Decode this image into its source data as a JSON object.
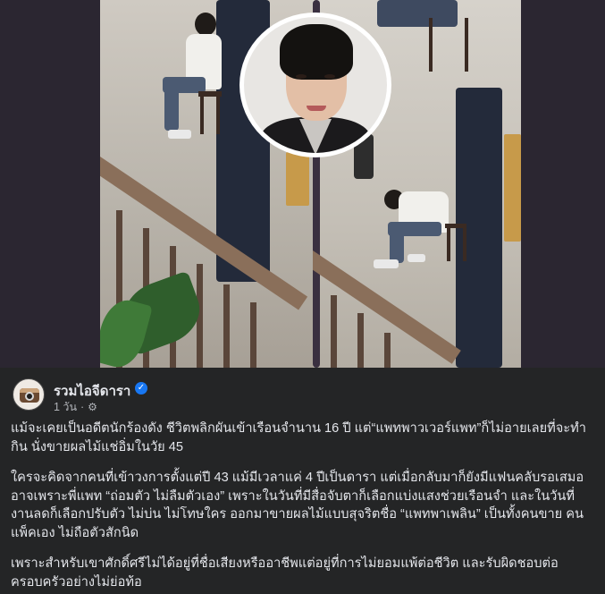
{
  "post": {
    "page_name": "รวมไอจีดารา",
    "time": "1 วัน",
    "separator": "·",
    "verified_icon": "verified-badge-icon",
    "privacy_icon": "gear-icon",
    "paragraphs": [
      "แม้จะเคยเป็นอดีตนักร้องดัง ชีวิตพลิกผันเข้าเรือนจำนาน 16 ปี แต่“แพทพาวเวอร์แพท”ก็ไม่อายเลยที่จะทำกิน นั่งขายผลไม้แช่อิ่มในวัย 45",
      "ใครจะคิดจากคนที่เข้าวงการตั้งแต่ปี 43 แม้มีเวลาแค่ 4 ปีเป็นดารา แต่เมื่อกลับมาก็ยังมีแฟนคลับรอเสมอ อาจเพราะพี่แพท “ถ่อมตัว ไม่ลืมตัวเอง” เพราะในวันที่มีสื่อจับตาก็เลือกแบ่งแสงช่วยเรือนจำ และในวันที่งานลดก็เลือกปรับตัว ไม่บ่น ไม่โทษใคร ออกมาขายผลไม้แบบสุจริตชื่อ “แพทพาเพลิน” เป็นทั้งคนขาย คนแพ็คเอง ไม่ถือตัวสักนิด",
      "เพราะสำหรับเขาศักดิ์ศรีไม่ได้อยู่ที่ชื่อเสียงหรืออาชีพแต่อยู่ที่การไม่ยอมแพ้ต่อชีวิต และรับผิดชอบต่อครอบครัวอย่างไม่ย่อท้อ"
    ]
  },
  "colors": {
    "background": "#242526",
    "text_primary": "#e4e6eb",
    "text_secondary": "#b0b3b8",
    "verified": "#1877f2"
  }
}
